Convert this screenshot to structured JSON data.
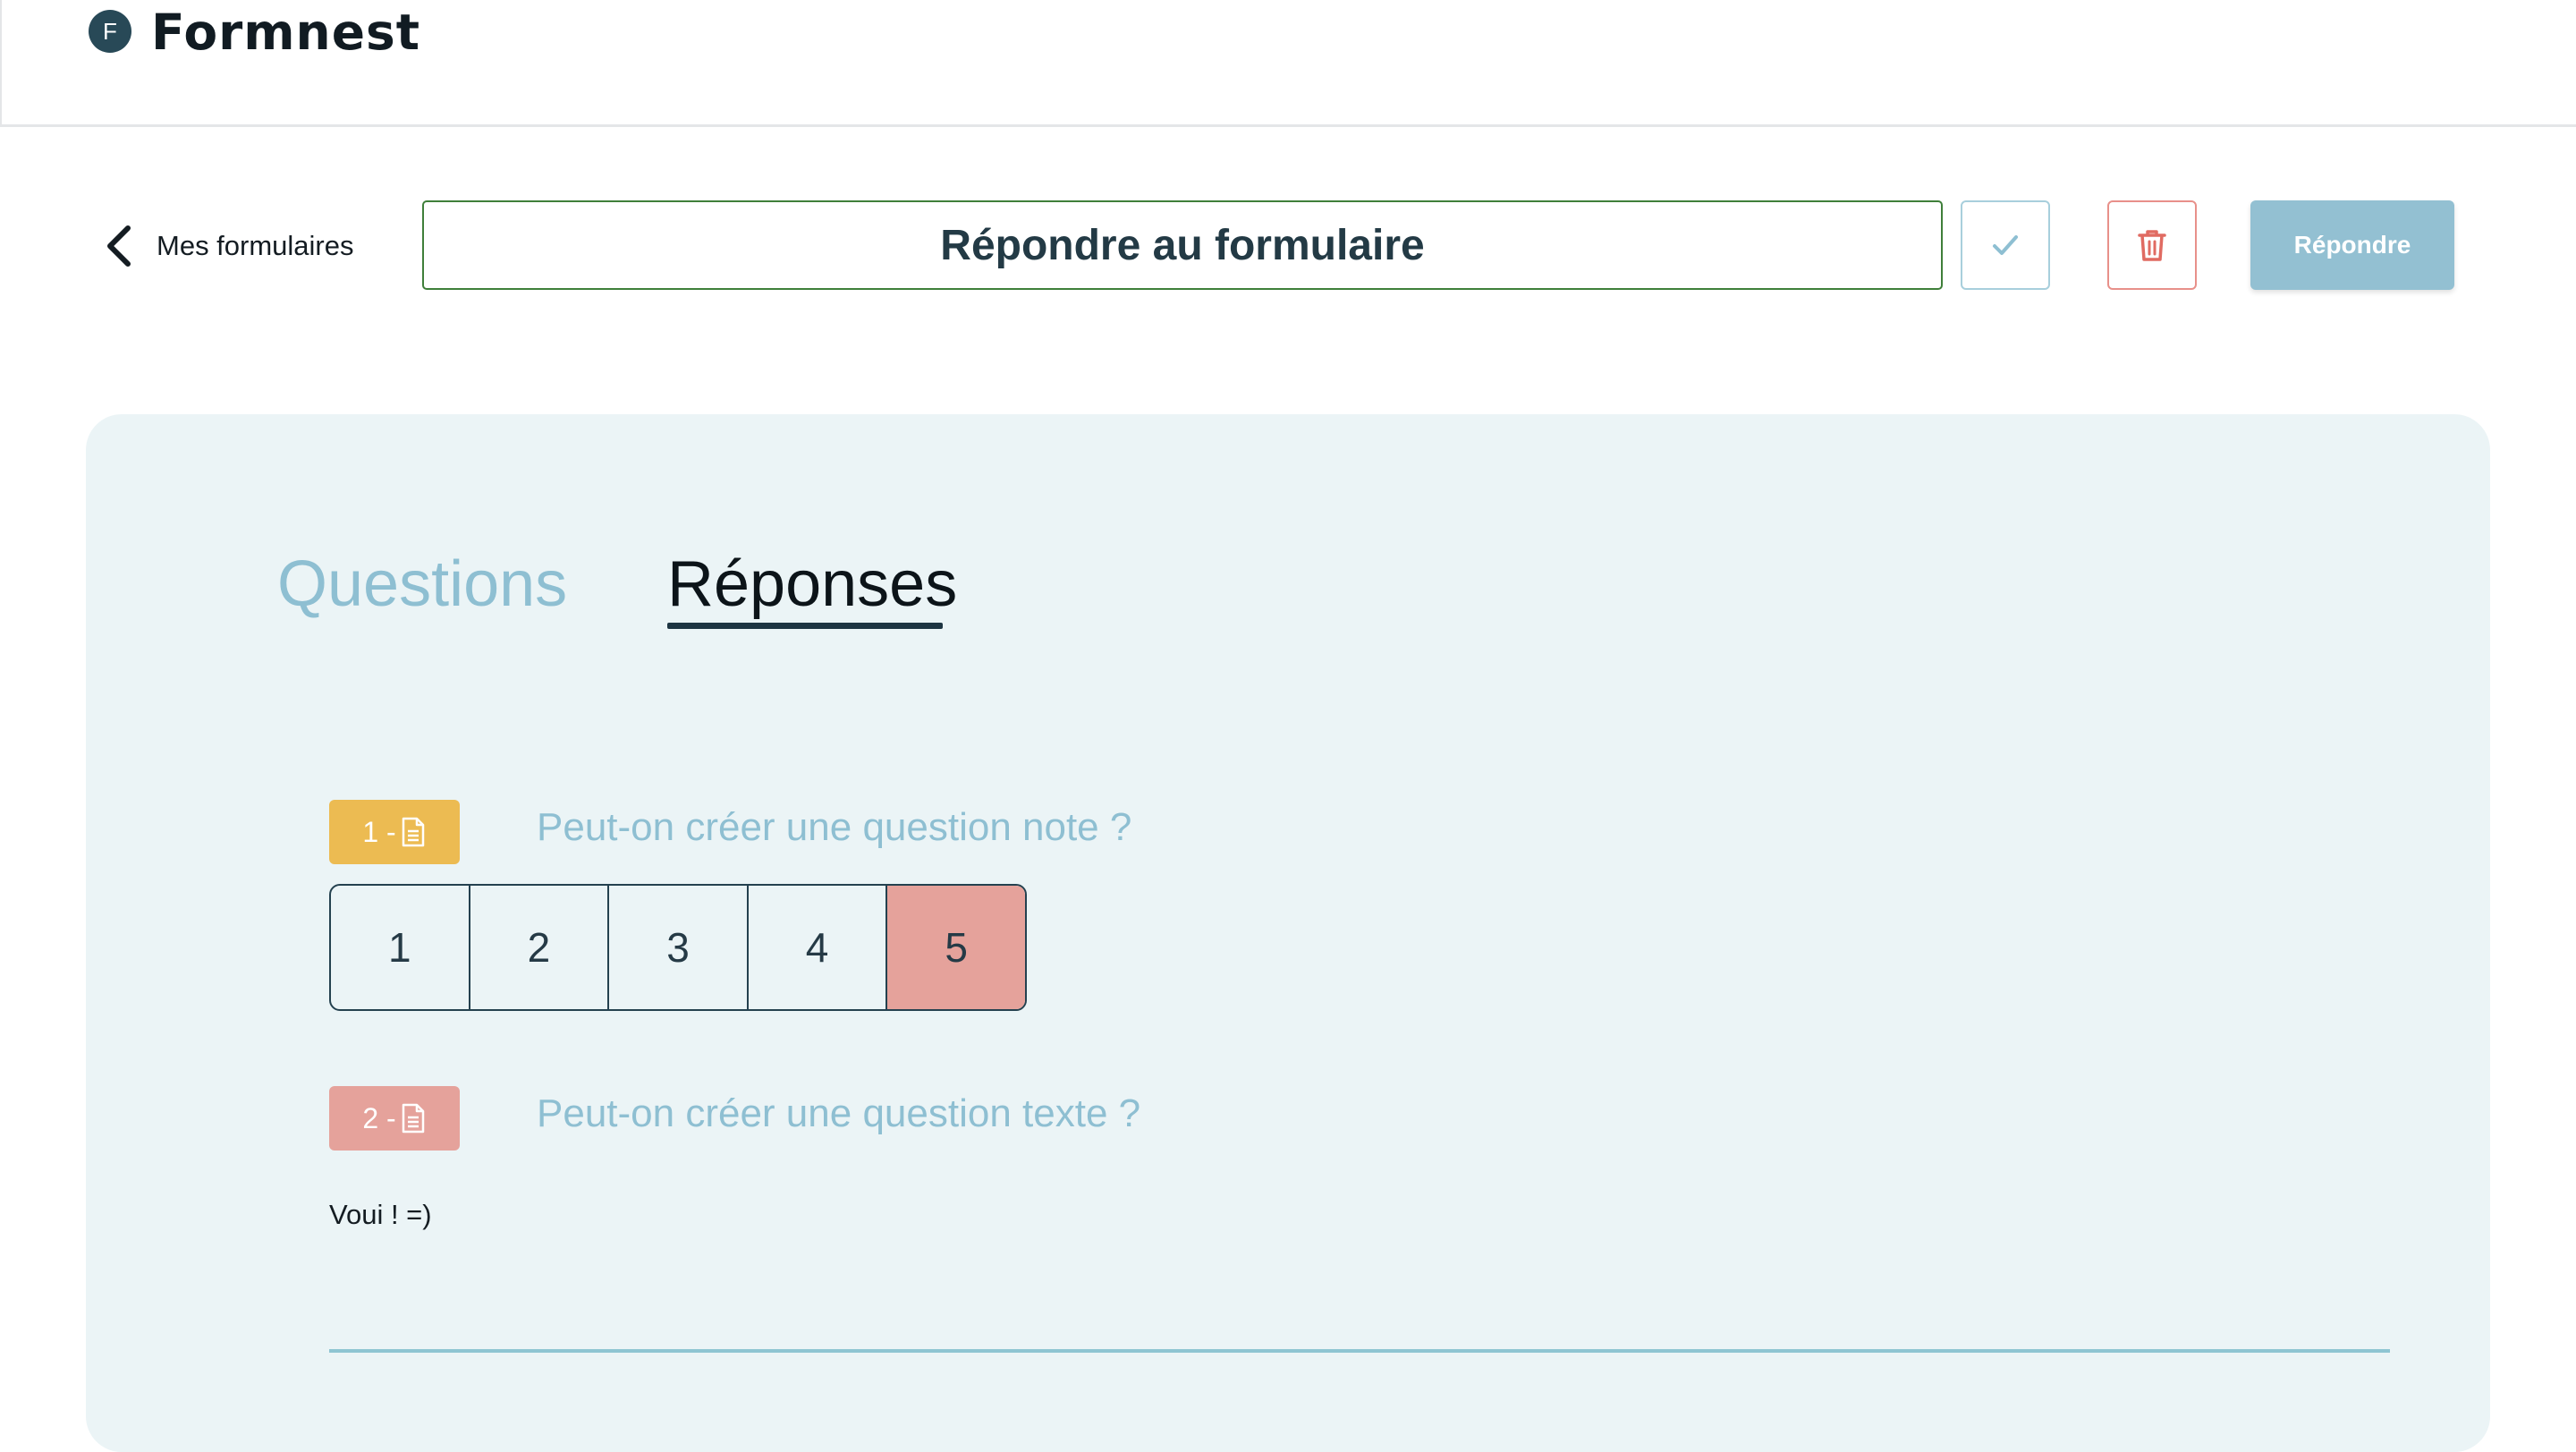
{
  "app": {
    "logo_letter": "F",
    "name": "Formnest"
  },
  "nav": {
    "back_label": "Mes formulaires"
  },
  "form": {
    "title": "Répondre au formulaire",
    "answer_button": "Répondre"
  },
  "tabs": [
    {
      "label": "Questions",
      "active": false
    },
    {
      "label": "Réponses",
      "active": true
    }
  ],
  "questions": [
    {
      "number": "1 -",
      "text": "Peut-on créer une question note ?",
      "type": "rating",
      "badge_color": "#ecbb52",
      "options": [
        "1",
        "2",
        "3",
        "4",
        "5"
      ],
      "selected": "5"
    },
    {
      "number": "2 -",
      "text": "Peut-on créer une question texte ?",
      "type": "text",
      "badge_color": "#e5a29b",
      "answer": "Voui ! =)"
    }
  ],
  "colors": {
    "accent": "#8ebfd2",
    "panel_bg": "#ebf4f6",
    "selected_rating": "#e5a29b",
    "confirm_border": "#3f7f3a",
    "delete": "#e8908a"
  },
  "icons": {
    "back": "chevron-left-icon",
    "confirm": "check-icon",
    "delete": "trash-icon",
    "question_type": "document-icon"
  }
}
